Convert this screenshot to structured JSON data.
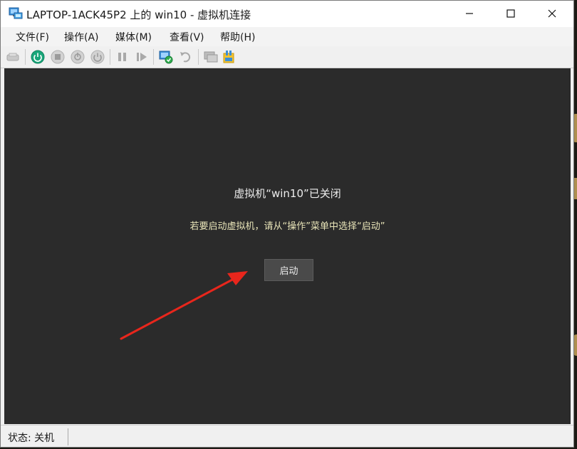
{
  "window": {
    "title": "LAPTOP-1ACK45P2 上的 win10 - 虚拟机连接"
  },
  "menu": [
    {
      "label": "文件(F)"
    },
    {
      "label": "操作(A)"
    },
    {
      "label": "媒体(M)"
    },
    {
      "label": "查看(V)"
    },
    {
      "label": "帮助(H)"
    }
  ],
  "toolbar": {
    "icons": [
      "ctrl-alt-del-icon",
      "start-icon",
      "turn-off-icon",
      "shutdown-icon",
      "save-icon",
      "pause-icon",
      "resume-icon",
      "checkpoint-icon",
      "revert-icon",
      "enhanced-session-icon",
      "share-icon"
    ]
  },
  "vm_screen": {
    "heading": "虚拟机“win10”已关闭",
    "message": "若要启动虚拟机，请从“操作”菜单中选择“启动”",
    "start_button": "启动"
  },
  "status": {
    "text": "状态: 关机"
  },
  "colors": {
    "screen_bg": "#2b2b2b",
    "message_text": "#e8e4b8",
    "annotation_arrow": "#e8261c",
    "start_icon_green": "#1aa67a"
  }
}
